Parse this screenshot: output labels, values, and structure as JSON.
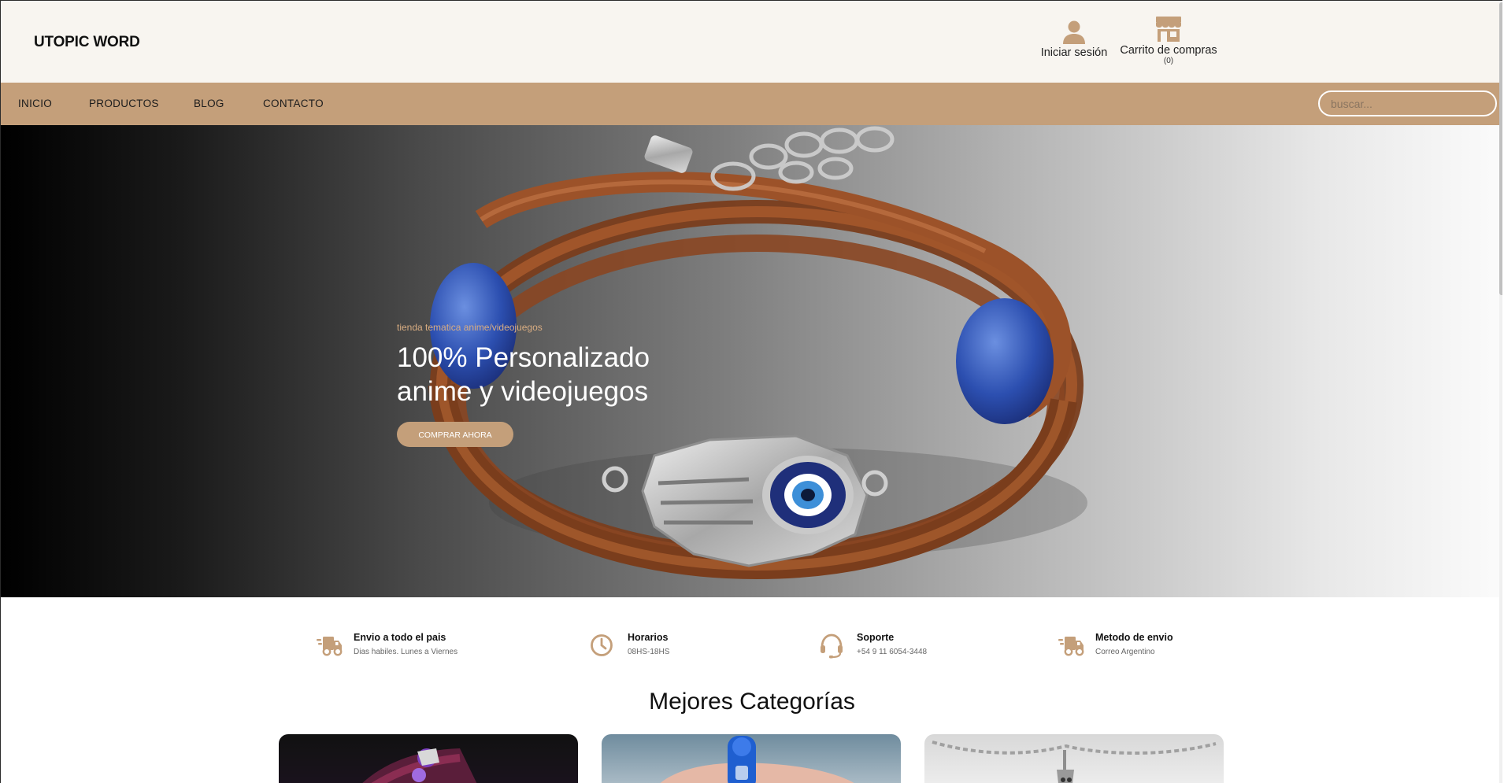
{
  "brand": {
    "name": "UTOPIC WORD"
  },
  "header": {
    "login_label": "Iniciar sesión",
    "cart_label": "Carrito de compras",
    "cart_count": "(0)"
  },
  "nav": {
    "items": [
      "INICIO",
      "PRODUCTOS",
      "BLOG",
      "CONTACTO"
    ],
    "search_placeholder": "buscar..."
  },
  "hero": {
    "kicker": "tienda tematica anime/videojuegos",
    "title_line1": "100% Personalizado",
    "title_line2": "anime y videojuegos",
    "cta": "COMPRAR AHORA"
  },
  "features": [
    {
      "icon": "truck-icon",
      "title": "Envio a todo el pais",
      "subtitle": "Dias habiles. Lunes a Viernes"
    },
    {
      "icon": "clock-icon",
      "title": "Horarios",
      "subtitle": "08HS-18HS"
    },
    {
      "icon": "headset-icon",
      "title": "Soporte",
      "subtitle": "+54 9 11 6054-3448"
    },
    {
      "icon": "truck-icon",
      "title": "Metodo de envio",
      "subtitle": "Correo Argentino"
    }
  ],
  "categories": {
    "title": "Mejores Categorías"
  },
  "colors": {
    "accent": "#c49f7a",
    "header_bg": "#f8f5f0",
    "icon": "#c49f7a"
  }
}
